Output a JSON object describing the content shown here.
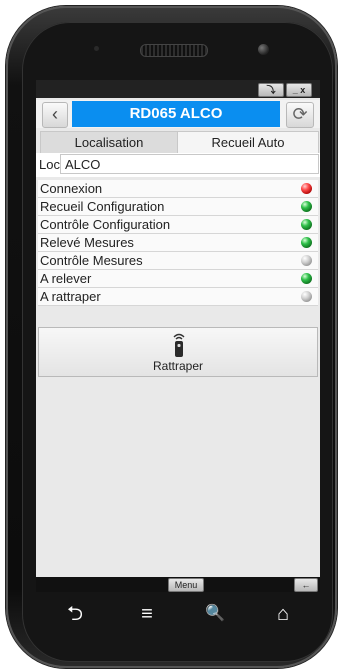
{
  "window": {
    "restore_btn": "⤵",
    "minmax_btn": "_ x"
  },
  "header": {
    "back_icon": "‹",
    "title": "RD065 ALCO",
    "sync_icon": "⟳"
  },
  "tabs": [
    {
      "label": "Localisation",
      "selected": false
    },
    {
      "label": "Recueil Auto",
      "selected": true
    }
  ],
  "location": {
    "label": "Loc",
    "value": "ALCO"
  },
  "status_list": [
    {
      "label": "Connexion",
      "status": "red"
    },
    {
      "label": "Recueil Configuration",
      "status": "green"
    },
    {
      "label": "Contrôle Configuration",
      "status": "green"
    },
    {
      "label": "Relevé Mesures",
      "status": "green"
    },
    {
      "label": "Contrôle Mesures",
      "status": "grey"
    },
    {
      "label": "A relever",
      "status": "green"
    },
    {
      "label": "A rattraper",
      "status": "grey"
    }
  ],
  "action": {
    "label": "Rattraper",
    "icon": "remote-icon"
  },
  "bottom": {
    "menu_label": "Menu",
    "back_label": "←"
  },
  "hardware_keys": {
    "back": "⮌",
    "menu": "≡",
    "search": "🔍",
    "home": "⌂"
  },
  "colors": {
    "title_bg": "#0a8ef0",
    "status_red": "#ff4a4a",
    "status_green": "#2fc04a",
    "status_grey": "#cfcfcf"
  }
}
